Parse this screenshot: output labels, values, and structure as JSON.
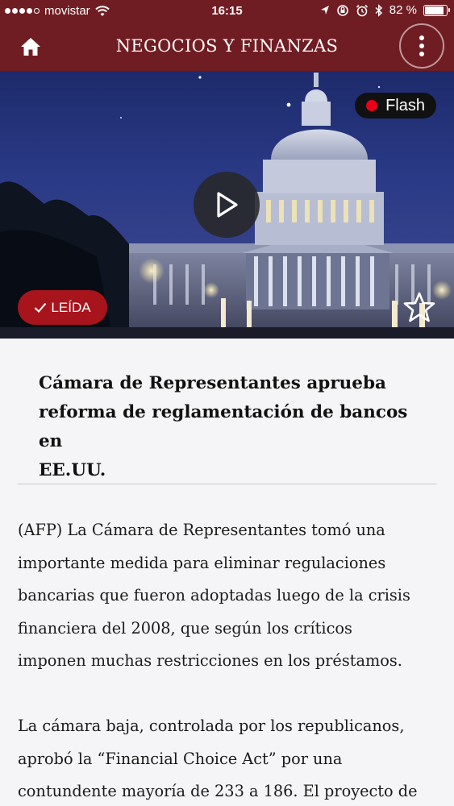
{
  "status_bar": {
    "carrier": "movistar",
    "time": "16:15",
    "battery": "82 %",
    "battery_level": 0.82,
    "icons": [
      "signal-dots",
      "wifi-icon",
      "location-icon",
      "rotation-lock-icon",
      "alarm-icon",
      "bluetooth-icon",
      "battery-icon"
    ]
  },
  "nav": {
    "title": "NEGOCIOS Y FINANZAS",
    "home_icon": "home-icon",
    "menu_icon": "more-vertical-icon"
  },
  "hero": {
    "flash_label": "Flash",
    "read_label": "LEÍDA",
    "play_icon": "play-icon",
    "star_icon": "star-outline-icon",
    "check_icon": "check-icon"
  },
  "article": {
    "headline_lines": [
      "Cámara de Representantes aprueba",
      "reforma de reglamentación de bancos en",
      "EE.UU."
    ],
    "paragraph1_lines": [
      "(AFP) La Cámara de Representantes tomó una",
      "importante medida para eliminar regulaciones",
      "bancarias que fueron adoptadas luego de la crisis",
      "financiera del 2008, que según los críticos",
      "imponen muchas restricciones en los préstamos."
    ],
    "paragraph2_lines": [
      "La cámara baja, controlada por los republicanos,",
      "aprobó la “Financial Choice Act” por una",
      "contundente mayoría de 233 a 186. El proyecto de"
    ]
  },
  "colors": {
    "brand_bar": "#6f1d23",
    "read_badge": "#a8141c",
    "flash_dot": "#e8001a"
  }
}
